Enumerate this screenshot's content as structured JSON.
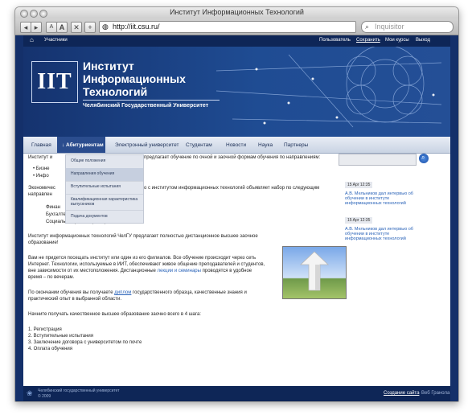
{
  "browser": {
    "title": "Институт Информационных Технологий",
    "url": "http://iit.csu.ru/",
    "search_placeholder": "Inquisitor",
    "btn_small_a": "A",
    "btn_big_a": "A",
    "btn_close": "✕",
    "btn_add": "+"
  },
  "topnav": {
    "participants": "Участники",
    "user": "Пользователь",
    "save": "Сохранить",
    "my_courses": "Мои курсы",
    "logout": "Выход"
  },
  "banner": {
    "logo": "IIT",
    "line1": "Институт",
    "line2": "Информационных",
    "line3": "Технологий",
    "university": "Челябинский Государственный Университет"
  },
  "menu": {
    "items": [
      "Главная",
      "↓ Абитуриентам",
      "Электронный университет",
      "Студентам",
      "Новости",
      "Наука",
      "Партнеры"
    ]
  },
  "dropdown": {
    "items": [
      "Общие положения",
      "Направления обучения",
      "Вступительные испытания",
      "Квалификационная характеристика выпускников",
      "Подача документов"
    ]
  },
  "main": {
    "intro_start": "Институт и",
    "intro_end": "предлагает обучение по очной и заочной формам обучения по направлениям:",
    "bullet1": "Бизне",
    "bullet2": "Инфо",
    "econ_start": "Экономичес",
    "econ_end": "о с институтом информационных технологий объявляет набор по следующим",
    "econ_line2": "направлен",
    "fin": "Финан",
    "acc": "Бухгалтерский учет, анализ и аудит (заоч.)",
    "social": "Социальная работа (заоч.)",
    "distance_1": "Институт информационных технологий ЧелГУ предлагает полностью дистанционное высшее заочное",
    "distance_2": "образование!",
    "p1": "Вам не придется посещать институт или один из его филиалов. Все обучение происходит через сеть",
    "p2": "Интернет. Технологии, используемые в ИИТ, обеспечивают живое общение преподавателей и студентов,",
    "p3_a": "вне зависимости от их местоположения. Дистанционные ",
    "p3_link": "лекции и семинары",
    "p3_b": " проводятся в удобное",
    "p4": "время – по вечерам.",
    "q1_a": "По окончании обучения вы получаете ",
    "q1_link": "диплом",
    "q1_b": " государственного образца, качественные знания и",
    "q2": "практический опыт в выбранной области.",
    "steps_intro": "Начните получать качественное высшее образование заочно всего в 4 шага:",
    "steps": [
      "1. Регистрация",
      "2. Вступительные испытания",
      "3. Заключение договора с университетом по почте",
      "4. Оплата обучения"
    ]
  },
  "sidebar": {
    "news": [
      {
        "date": "15 Apr 12:35",
        "text": "А.В. Мельников дал интервью об обучении в институте информационных технологий"
      },
      {
        "date": "15 Apr 12:35",
        "text": "А.В. Мельников дал интервью об обучении в институте информационных технологий"
      }
    ]
  },
  "footer": {
    "org": "Челябинский государственный университет",
    "year": "© 2009",
    "credit_link": "Создание сайта",
    "credit_name": " – Веб Гранола"
  }
}
